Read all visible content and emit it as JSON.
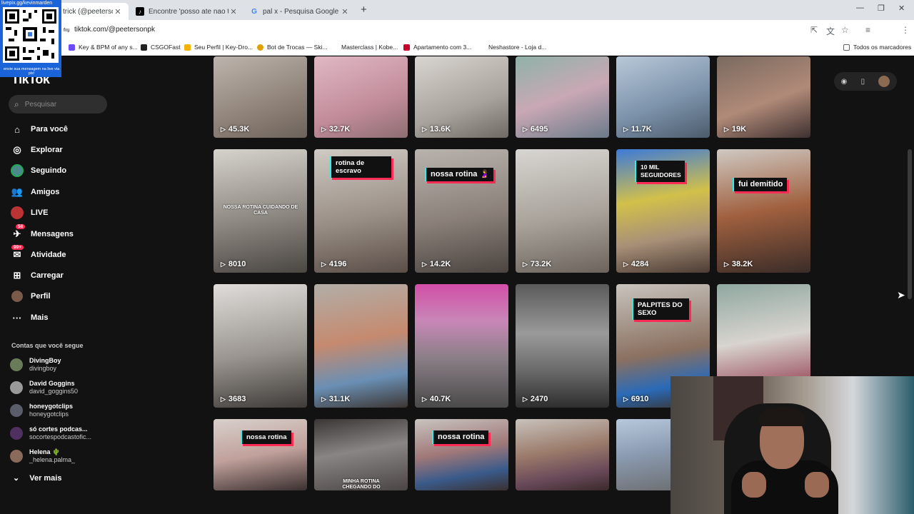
{
  "browser": {
    "tabs": [
      {
        "title": "trick (@peetersonpk",
        "active": true
      },
      {
        "title": "Encontre 'posso ate nao te da",
        "active": false
      },
      {
        "title": "pal x - Pesquisa Google",
        "active": false
      }
    ],
    "url": "tiktok.com/@peetersonpk",
    "bookmarks": [
      "Key & BPM of any s...",
      "CSGOFast",
      "Seu Perfil | Key-Dro...",
      "Bot de Trocas — Ski...",
      "Masterclass | Kobe...",
      "Apartamento com 3...",
      "Neshastore - Loja d..."
    ],
    "all_bookmarks": "Todos os marcadores"
  },
  "qr_overlay": {
    "top": "livepix.gg/kevinmarden",
    "bottom": "envie sua mensagem na live via pix!"
  },
  "sidebar": {
    "logo": "TikTok",
    "search_placeholder": "Pesquisar",
    "nav": [
      {
        "label": "Para você",
        "icon": "home-icon"
      },
      {
        "label": "Explorar",
        "icon": "compass-icon"
      },
      {
        "label": "Seguindo",
        "icon": "following-icon"
      },
      {
        "label": "Amigos",
        "icon": "friends-icon"
      },
      {
        "label": "LIVE",
        "icon": "live-icon"
      },
      {
        "label": "Mensagens",
        "icon": "messages-icon",
        "badge": "58"
      },
      {
        "label": "Atividade",
        "icon": "activity-icon",
        "badge": "99+"
      },
      {
        "label": "Carregar",
        "icon": "upload-icon"
      },
      {
        "label": "Perfil",
        "icon": "profile-icon"
      },
      {
        "label": "Mais",
        "icon": "more-icon"
      }
    ],
    "following_title": "Contas que você segue",
    "following": [
      {
        "name": "DivingBoy",
        "user": "divingboy"
      },
      {
        "name": "David Goggins",
        "user": "david_goggins50"
      },
      {
        "name": "honeygotclips",
        "user": "honeygotclips"
      },
      {
        "name": "só cortes podcas...",
        "user": "socortespodcastofic..."
      },
      {
        "name": "Helena 🌵",
        "user": "_helena.palma_"
      }
    ],
    "see_more": "Ver mais"
  },
  "videos": [
    {
      "views": "45.3K"
    },
    {
      "views": "32.7K"
    },
    {
      "views": "13.6K"
    },
    {
      "views": "6495"
    },
    {
      "views": "11.7K"
    },
    {
      "views": "19K"
    },
    {
      "views": "8010",
      "overlay": "NOSSA ROTINA CUIDANDO DE CASA"
    },
    {
      "views": "4196",
      "caption": "rotina de escravo"
    },
    {
      "views": "14.2K",
      "caption": "nossa rotina 🤰"
    },
    {
      "views": "73.2K"
    },
    {
      "views": "4284",
      "caption": "10 MIL SEGUIDORES"
    },
    {
      "views": "38.2K",
      "caption": "fui demitido"
    },
    {
      "views": "3683"
    },
    {
      "views": "31.1K"
    },
    {
      "views": "40.7K"
    },
    {
      "views": "2470"
    },
    {
      "views": "6910",
      "caption": "PALPITES DO SEXO"
    },
    {
      "views": ""
    },
    {
      "views": "",
      "caption": "nossa rotina"
    },
    {
      "views": "",
      "overlay": "MINHA ROTINA CHEGANDO DO TRABALHO"
    },
    {
      "views": "",
      "caption": "nossa rotina"
    },
    {
      "views": ""
    },
    {
      "views": ""
    },
    {
      "views": ""
    }
  ]
}
